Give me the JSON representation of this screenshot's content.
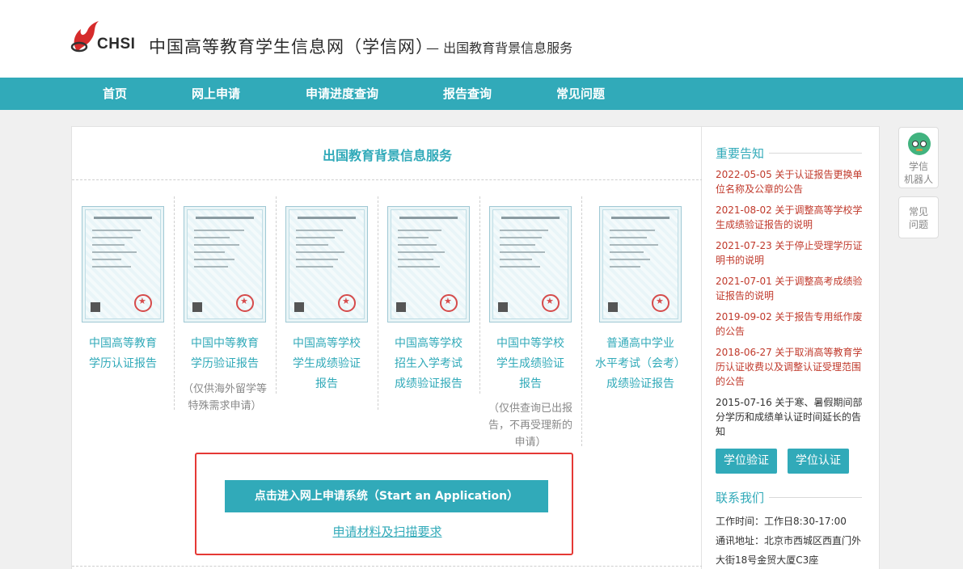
{
  "header": {
    "logo_text": "CHSI",
    "title": "中国高等教育学生信息网（学信网）",
    "subtitle": "— 出国教育背景信息服务"
  },
  "nav": {
    "items": [
      {
        "label": "首页"
      },
      {
        "label": "网上申请"
      },
      {
        "label": "申请进度查询"
      },
      {
        "label": "报告查询"
      },
      {
        "label": "常见问题"
      }
    ]
  },
  "main": {
    "title": "出国教育背景信息服务",
    "reports": [
      {
        "name_lines": [
          "中国高等教育",
          "学历认证报告"
        ],
        "note_lines": []
      },
      {
        "name_lines": [
          "中国中等教育",
          "学历验证报告"
        ],
        "note_lines": [
          "（仅供海外留学等",
          "特殊需求申请）"
        ]
      },
      {
        "name_lines": [
          "中国高等学校",
          "学生成绩验证",
          "报告"
        ],
        "note_lines": []
      },
      {
        "name_lines": [
          "中国高等学校",
          "招生入学考试",
          "成绩验证报告"
        ],
        "note_lines": []
      },
      {
        "name_lines": [
          "中国中等学校",
          "学生成绩验证",
          "报告"
        ],
        "note_lines": [
          "（仅供查询已出报",
          "告，不再受理新的",
          "申请）"
        ]
      },
      {
        "name_lines": [
          "普通高中学业",
          "水平考试（会考）",
          "成绩验证报告"
        ],
        "note_lines": []
      }
    ],
    "apply_button": "点击进入网上申请系统（Start an Application）",
    "requirements_link": "申请材料及扫描要求"
  },
  "sidebar": {
    "notices_heading": "重要告知",
    "notices": [
      {
        "lines": [
          "2022-05-05 关于认证报告更换单",
          "位名称及公章的公告"
        ]
      },
      {
        "lines": [
          "2021-08-02 关于调整高等学校学",
          "生成绩验证报告的说明"
        ]
      },
      {
        "lines": [
          "2021-07-23 关于停止受理学历证",
          "明书的说明"
        ]
      },
      {
        "lines": [
          "2021-07-01 关于调整高考成绩验",
          "证报告的说明"
        ]
      },
      {
        "lines": [
          "2019-09-02 关于报告专用纸作废",
          "的公告"
        ]
      },
      {
        "lines": [
          "2018-06-27 关于取消高等教育学",
          "历认证收费以及调整认证受理范围",
          "的公告"
        ]
      },
      {
        "lines": [
          "2015-07-16 关于寒、暑假期间部",
          "分学历和成绩单认证时间延长的告",
          "知"
        ]
      }
    ],
    "buttons": [
      "学位验证",
      "学位认证"
    ],
    "contact_heading": "联系我们",
    "contact_lines": [
      "工作时间：工作日8:30-17:00",
      "通讯地址：北京市西城区西直门外",
      "大街18号金贸大厦C3座"
    ]
  },
  "floating": {
    "robot_label_lines": [
      "学信",
      "机器人"
    ],
    "faq_label_lines": [
      "常见",
      "问题"
    ]
  }
}
